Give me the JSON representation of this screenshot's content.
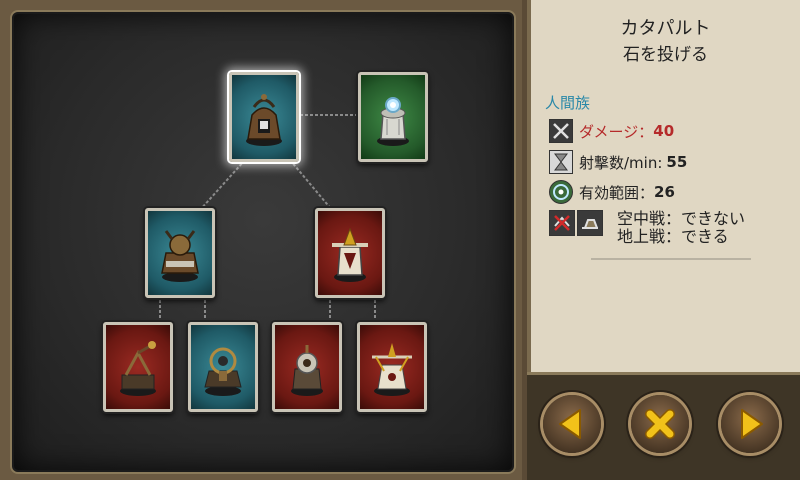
{
  "tower": {
    "name": "カタパルト",
    "description": "石を投げる",
    "race": "人間族"
  },
  "stats": {
    "damage_label": "ダメージ：",
    "damage_value": "40",
    "rate_label": "射撃数/min:",
    "rate_value": "55",
    "range_label": "有効範囲：",
    "range_value": "26"
  },
  "targets": {
    "air": "空中戦：できない",
    "ground": "地上戦：できる"
  },
  "tree": [
    {
      "id": "catapult",
      "color": "blue",
      "selected": true
    },
    {
      "id": "crystal",
      "color": "green"
    },
    {
      "id": "blue-2a",
      "color": "blue"
    },
    {
      "id": "red-2b",
      "color": "red"
    },
    {
      "id": "red-3a",
      "color": "red"
    },
    {
      "id": "blue-3b",
      "color": "blue"
    },
    {
      "id": "red-3c",
      "color": "red"
    },
    {
      "id": "red-3d",
      "color": "red"
    }
  ],
  "buttons": {
    "prev": "previous-arrow-icon",
    "close": "close-x-icon",
    "next": "next-arrow-icon"
  },
  "colors": {
    "accent_blue": "#2a88a8",
    "damage_red": "#b52a2a",
    "button_gold": "#f2c21a"
  }
}
